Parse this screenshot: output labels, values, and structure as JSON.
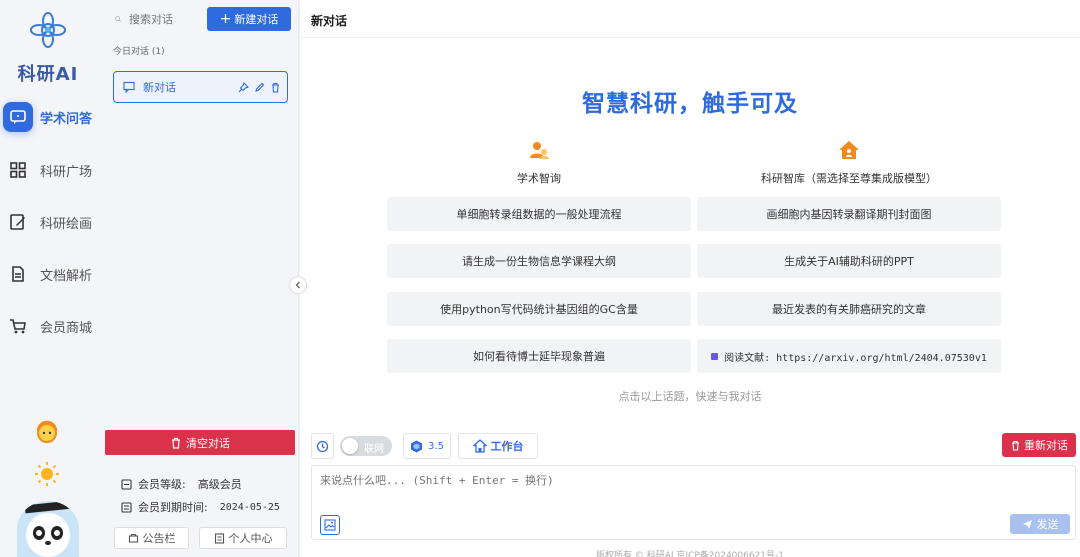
{
  "brand": {
    "name": "科研AI"
  },
  "nav": [
    {
      "label": "学术问答",
      "icon": "chat-icon",
      "active": true
    },
    {
      "label": "科研广场",
      "icon": "grid-icon",
      "active": false
    },
    {
      "label": "科研绘画",
      "icon": "paint-icon",
      "active": false
    },
    {
      "label": "文档解析",
      "icon": "document-icon",
      "active": false
    },
    {
      "label": "会员商城",
      "icon": "cart-icon",
      "active": false
    }
  ],
  "rail_tools": {
    "support_icon": "support-icon",
    "theme_icon": "sun-icon"
  },
  "sidebar": {
    "search_placeholder": "搜索对话",
    "new_chat_label": "新建对话",
    "group_label": "今日对话 (1)",
    "chats": [
      {
        "label": "新对话"
      }
    ],
    "clear_label": "清空对话",
    "member_level_label": "会员等级:",
    "member_level_value": "高级会员",
    "expire_label": "会员到期时间:",
    "expire_value": "2024-05-25",
    "notice_label": "公告栏",
    "profile_label": "个人中心"
  },
  "main": {
    "title": "新对话",
    "hero": "智慧科研，触手可及",
    "col_left_title": "学术智询",
    "col_right_title": "科研智库（需选择至尊集成版模型）",
    "suggestions_left": [
      "单细胞转录组数据的一般处理流程",
      "请生成一份生物信息学课程大纲",
      "使用python写代码统计基因组的GC含量",
      "如何看待博士延毕现象普遍"
    ],
    "suggestions_right": [
      "画细胞内基因转录翻译期刊封面图",
      "生成关于AI辅助科研的PPT",
      "最近发表的有关肺癌研究的文章",
      "阅读文献: https://arxiv.org/html/2404.07530v1"
    ],
    "hint": "点击以上话题，快速与我对话",
    "toggle_label": "联网",
    "model_label": "3.5",
    "workbench_label": "工作台",
    "restart_label": "重新对话",
    "input_placeholder": "来说点什么吧... (Shift + Enter = 换行)",
    "send_label": "发送",
    "footer": "版权所有 © 科研AI 京ICP备2024006621号-1"
  },
  "colors": {
    "accent": "#2f6bde",
    "danger": "#d9324a"
  }
}
